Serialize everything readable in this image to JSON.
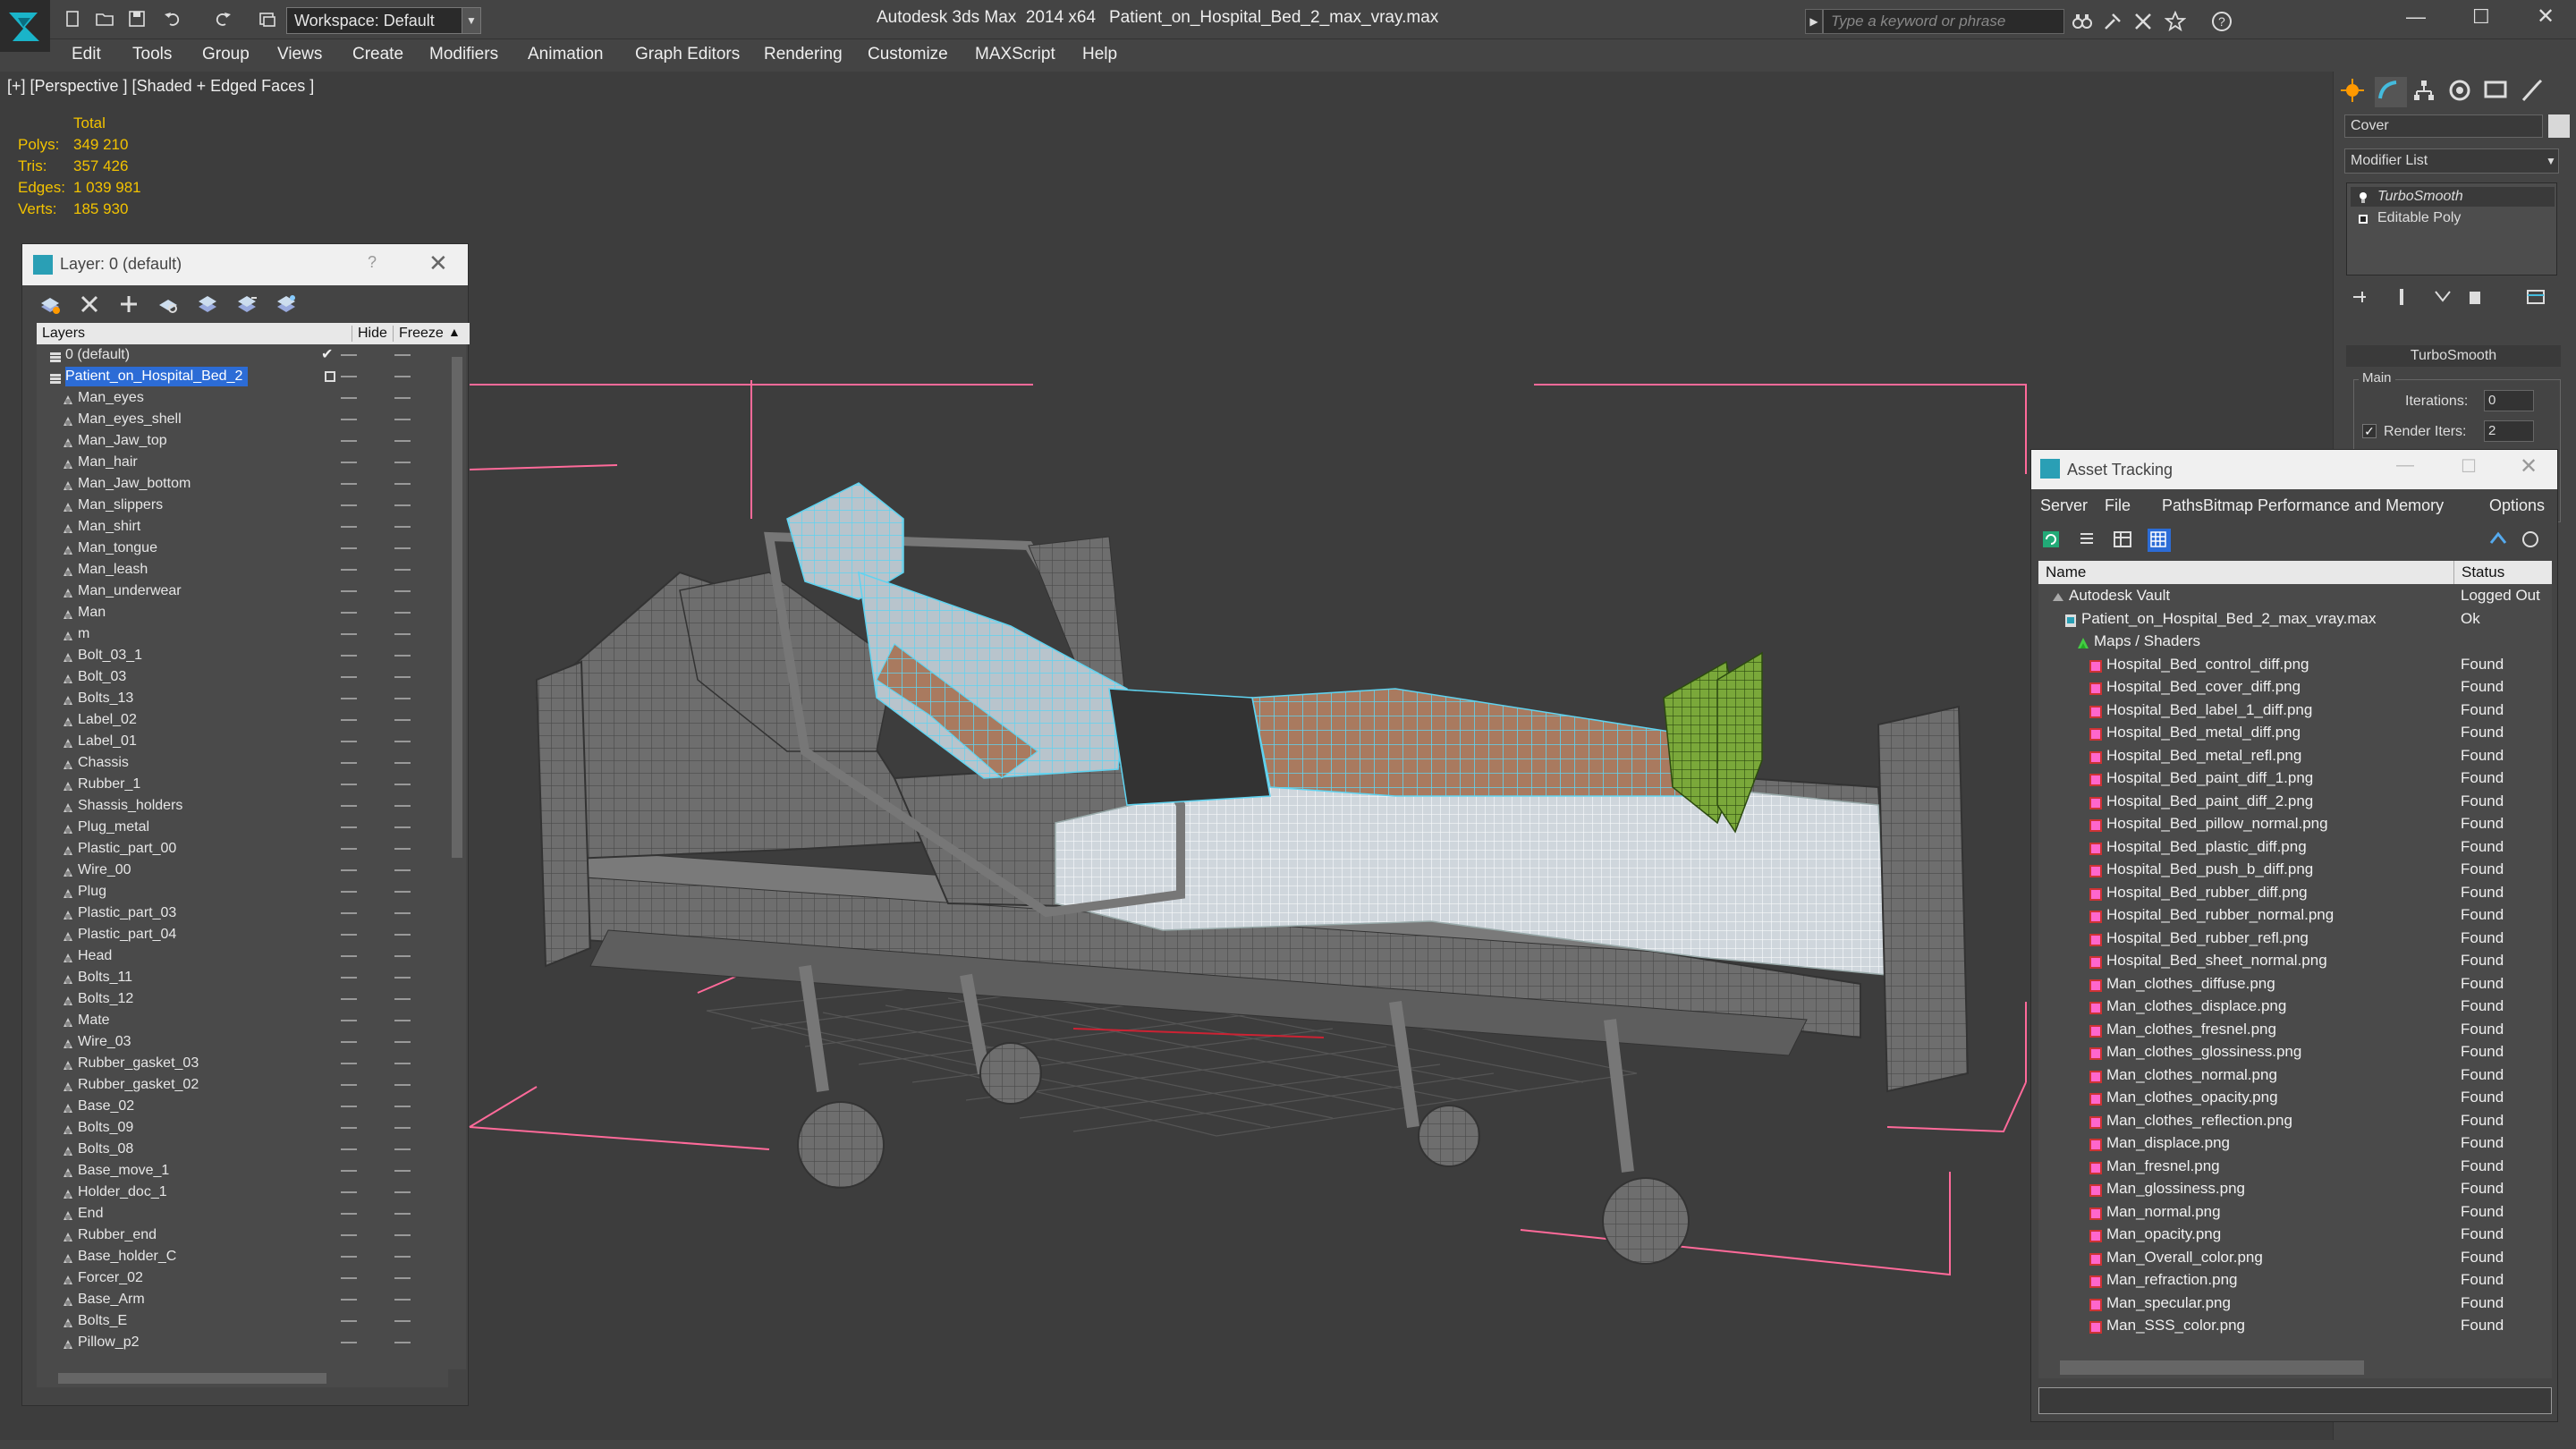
{
  "window": {
    "app_title": "Autodesk 3ds Max  2014 x64",
    "file_title": "Patient_on_Hospital_Bed_2_max_vray.max",
    "workspace": "Workspace: Default",
    "search_placeholder": "Type a keyword or phrase"
  },
  "menu": [
    "Edit",
    "Tools",
    "Group",
    "Views",
    "Create",
    "Modifiers",
    "Animation",
    "Graph Editors",
    "Rendering",
    "Customize",
    "MAXScript",
    "Help"
  ],
  "viewport": {
    "label": "[+] [Perspective ] [Shaded + Edged Faces ]",
    "stats_header": "Total",
    "stats": [
      {
        "label": "Polys:",
        "value": "349 210"
      },
      {
        "label": "Tris:",
        "value": "357 426"
      },
      {
        "label": "Edges:",
        "value": "1 039 981"
      },
      {
        "label": "Verts:",
        "value": "185 930"
      }
    ]
  },
  "layer_panel": {
    "title": "Layer: 0 (default)",
    "help": "?",
    "col_layers": "Layers",
    "col_hide": "Hide",
    "col_freeze": "Freeze",
    "rows": [
      {
        "name": "0 (default)",
        "level": 0,
        "checked": true
      },
      {
        "name": "Patient_on_Hospital_Bed_2",
        "level": 0,
        "selected": true
      },
      {
        "name": "Man_eyes",
        "level": 1
      },
      {
        "name": "Man_eyes_shell",
        "level": 1
      },
      {
        "name": "Man_Jaw_top",
        "level": 1
      },
      {
        "name": "Man_hair",
        "level": 1
      },
      {
        "name": "Man_Jaw_bottom",
        "level": 1
      },
      {
        "name": "Man_slippers",
        "level": 1
      },
      {
        "name": "Man_shirt",
        "level": 1
      },
      {
        "name": "Man_tongue",
        "level": 1
      },
      {
        "name": "Man_leash",
        "level": 1
      },
      {
        "name": "Man_underwear",
        "level": 1
      },
      {
        "name": "Man",
        "level": 1
      },
      {
        "name": "m",
        "level": 1
      },
      {
        "name": "Bolt_03_1",
        "level": 1
      },
      {
        "name": "Bolt_03",
        "level": 1
      },
      {
        "name": "Bolts_13",
        "level": 1
      },
      {
        "name": "Label_02",
        "level": 1
      },
      {
        "name": "Label_01",
        "level": 1
      },
      {
        "name": "Chassis",
        "level": 1
      },
      {
        "name": "Rubber_1",
        "level": 1
      },
      {
        "name": "Shassis_holders",
        "level": 1
      },
      {
        "name": "Plug_metal",
        "level": 1
      },
      {
        "name": "Plastic_part_00",
        "level": 1
      },
      {
        "name": "Wire_00",
        "level": 1
      },
      {
        "name": "Plug",
        "level": 1
      },
      {
        "name": "Plastic_part_03",
        "level": 1
      },
      {
        "name": "Plastic_part_04",
        "level": 1
      },
      {
        "name": "Head",
        "level": 1
      },
      {
        "name": "Bolts_11",
        "level": 1
      },
      {
        "name": "Bolts_12",
        "level": 1
      },
      {
        "name": "Mate",
        "level": 1
      },
      {
        "name": "Wire_03",
        "level": 1
      },
      {
        "name": "Rubber_gasket_03",
        "level": 1
      },
      {
        "name": "Rubber_gasket_02",
        "level": 1
      },
      {
        "name": "Base_02",
        "level": 1
      },
      {
        "name": "Bolts_09",
        "level": 1
      },
      {
        "name": "Bolts_08",
        "level": 1
      },
      {
        "name": "Base_move_1",
        "level": 1
      },
      {
        "name": "Holder_doc_1",
        "level": 1
      },
      {
        "name": "End",
        "level": 1
      },
      {
        "name": "Rubber_end",
        "level": 1
      },
      {
        "name": "Base_holder_C",
        "level": 1
      },
      {
        "name": "Forcer_02",
        "level": 1
      },
      {
        "name": "Base_Arm",
        "level": 1
      },
      {
        "name": "Bolts_E",
        "level": 1
      },
      {
        "name": "Pillow_p2",
        "level": 1
      }
    ]
  },
  "command_panel": {
    "object_name": "Cover",
    "modifier_list": "Modifier List",
    "stack": [
      "TurboSmooth",
      "Editable Poly"
    ],
    "rollout": "TurboSmooth",
    "group": "Main",
    "iterations_label": "Iterations:",
    "iterations_value": "0",
    "render_iters_label": "Render Iters:",
    "render_iters_value": "2"
  },
  "asset_tracking": {
    "title": "Asset Tracking",
    "menu": [
      "Server",
      "File",
      "Paths",
      "Bitmap Performance and Memory",
      "Options"
    ],
    "col_name": "Name",
    "col_status": "Status",
    "rows": [
      {
        "name": "Autodesk Vault",
        "status": "Logged Out",
        "level": 0,
        "icon": "vault"
      },
      {
        "name": "Patient_on_Hospital_Bed_2_max_vray.max",
        "status": "Ok",
        "level": 1,
        "icon": "max"
      },
      {
        "name": "Maps / Shaders",
        "status": "",
        "level": 2,
        "icon": "maps"
      },
      {
        "name": "Hospital_Bed_control_diff.png",
        "status": "Found",
        "level": 3,
        "icon": "png"
      },
      {
        "name": "Hospital_Bed_cover_diff.png",
        "status": "Found",
        "level": 3,
        "icon": "png"
      },
      {
        "name": "Hospital_Bed_label_1_diff.png",
        "status": "Found",
        "level": 3,
        "icon": "png"
      },
      {
        "name": "Hospital_Bed_metal_diff.png",
        "status": "Found",
        "level": 3,
        "icon": "png"
      },
      {
        "name": "Hospital_Bed_metal_refl.png",
        "status": "Found",
        "level": 3,
        "icon": "png"
      },
      {
        "name": "Hospital_Bed_paint_diff_1.png",
        "status": "Found",
        "level": 3,
        "icon": "png"
      },
      {
        "name": "Hospital_Bed_paint_diff_2.png",
        "status": "Found",
        "level": 3,
        "icon": "png"
      },
      {
        "name": "Hospital_Bed_pillow_normal.png",
        "status": "Found",
        "level": 3,
        "icon": "png"
      },
      {
        "name": "Hospital_Bed_plastic_diff.png",
        "status": "Found",
        "level": 3,
        "icon": "png"
      },
      {
        "name": "Hospital_Bed_push_b_diff.png",
        "status": "Found",
        "level": 3,
        "icon": "png"
      },
      {
        "name": "Hospital_Bed_rubber_diff.png",
        "status": "Found",
        "level": 3,
        "icon": "png"
      },
      {
        "name": "Hospital_Bed_rubber_normal.png",
        "status": "Found",
        "level": 3,
        "icon": "png"
      },
      {
        "name": "Hospital_Bed_rubber_refl.png",
        "status": "Found",
        "level": 3,
        "icon": "png"
      },
      {
        "name": "Hospital_Bed_sheet_normal.png",
        "status": "Found",
        "level": 3,
        "icon": "png"
      },
      {
        "name": "Man_clothes_diffuse.png",
        "status": "Found",
        "level": 3,
        "icon": "png"
      },
      {
        "name": "Man_clothes_displace.png",
        "status": "Found",
        "level": 3,
        "icon": "png"
      },
      {
        "name": "Man_clothes_fresnel.png",
        "status": "Found",
        "level": 3,
        "icon": "png"
      },
      {
        "name": "Man_clothes_glossiness.png",
        "status": "Found",
        "level": 3,
        "icon": "png"
      },
      {
        "name": "Man_clothes_normal.png",
        "status": "Found",
        "level": 3,
        "icon": "png"
      },
      {
        "name": "Man_clothes_opacity.png",
        "status": "Found",
        "level": 3,
        "icon": "png"
      },
      {
        "name": "Man_clothes_reflection.png",
        "status": "Found",
        "level": 3,
        "icon": "png"
      },
      {
        "name": "Man_displace.png",
        "status": "Found",
        "level": 3,
        "icon": "png"
      },
      {
        "name": "Man_fresnel.png",
        "status": "Found",
        "level": 3,
        "icon": "png"
      },
      {
        "name": "Man_glossiness.png",
        "status": "Found",
        "level": 3,
        "icon": "png"
      },
      {
        "name": "Man_normal.png",
        "status": "Found",
        "level": 3,
        "icon": "png"
      },
      {
        "name": "Man_opacity.png",
        "status": "Found",
        "level": 3,
        "icon": "png"
      },
      {
        "name": "Man_Overall_color.png",
        "status": "Found",
        "level": 3,
        "icon": "png"
      },
      {
        "name": "Man_refraction.png",
        "status": "Found",
        "level": 3,
        "icon": "png"
      },
      {
        "name": "Man_specular.png",
        "status": "Found",
        "level": 3,
        "icon": "png"
      },
      {
        "name": "Man_SSS_color.png",
        "status": "Found",
        "level": 3,
        "icon": "png"
      }
    ]
  },
  "colors": {
    "stats": "#f2c200",
    "selection": "#2c6cd6",
    "wire_cyan": "#5fd3f0",
    "bbox_pink": "#ff6a9a"
  }
}
